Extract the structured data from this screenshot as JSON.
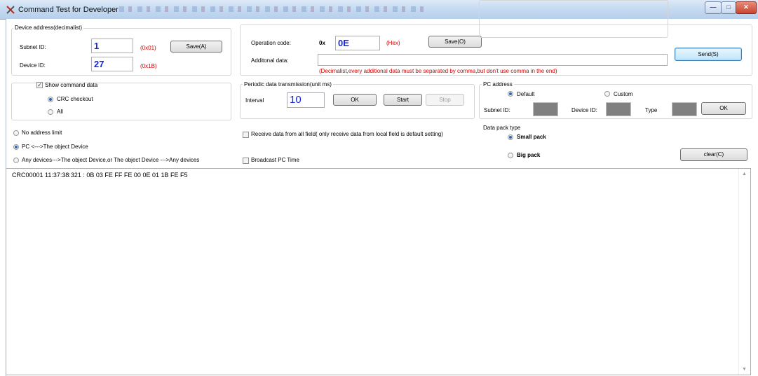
{
  "window": {
    "title": "Command Test for Developer"
  },
  "device_address": {
    "group_title": "Device address(decimalist)",
    "subnet_label": "Subnet ID:",
    "subnet_value": "1",
    "subnet_hex": "(0x01)",
    "device_label": "Device ID:",
    "device_value": "27",
    "device_hex": "(0x1B)",
    "save_label": "Save(A)"
  },
  "operation": {
    "code_label": "Operation code:",
    "prefix": "0x",
    "code_value": "0E",
    "hex_note": "(Hex)",
    "save_label": "Save(O)",
    "additional_label": "Additonal data:",
    "additional_value": "",
    "hint": "(Decimalist,every additional data must be separated by comma,but don't use comma in the end)",
    "send_label": "Send(S)"
  },
  "show_command": {
    "checkbox_label": "Show command data",
    "checked": true,
    "options": [
      "CRC checkout",
      "All"
    ],
    "selected": "CRC checkout"
  },
  "periodic": {
    "group_title": "Periodic data transmission(unit ms)",
    "interval_label": "Interval",
    "interval_value": "10",
    "ok_label": "OK",
    "start_label": "Start",
    "stop_label": "Stop"
  },
  "pc_address": {
    "group_title": "PC address",
    "default_label": "Default",
    "custom_label": "Custom",
    "selected": "Default",
    "subnet_label": "Subnet ID:",
    "device_label": "Device ID:",
    "type_label": "Type",
    "ok_label": "OK"
  },
  "address_limit": {
    "options": [
      "No address limit",
      "PC <--->The object Device",
      "Any devices--->The object Device,or The object Device --->Any devices"
    ],
    "selected": "PC <--->The object Device"
  },
  "receive_all": {
    "label": "Receive data from all field( only receive data from local field is default setting)",
    "checked": false
  },
  "broadcast": {
    "label": "Broadcast PC Time",
    "checked": false
  },
  "data_pack": {
    "group_title": "Data pack type",
    "small_label": "Small pack",
    "big_label": "Big pack",
    "selected": "Small pack"
  },
  "clear_label": "clear(C)",
  "log": {
    "lines": [
      "CRC00001 11:37:38:321 : 0B 03 FE FF FE 00 0E 01 1B FE F5"
    ]
  }
}
